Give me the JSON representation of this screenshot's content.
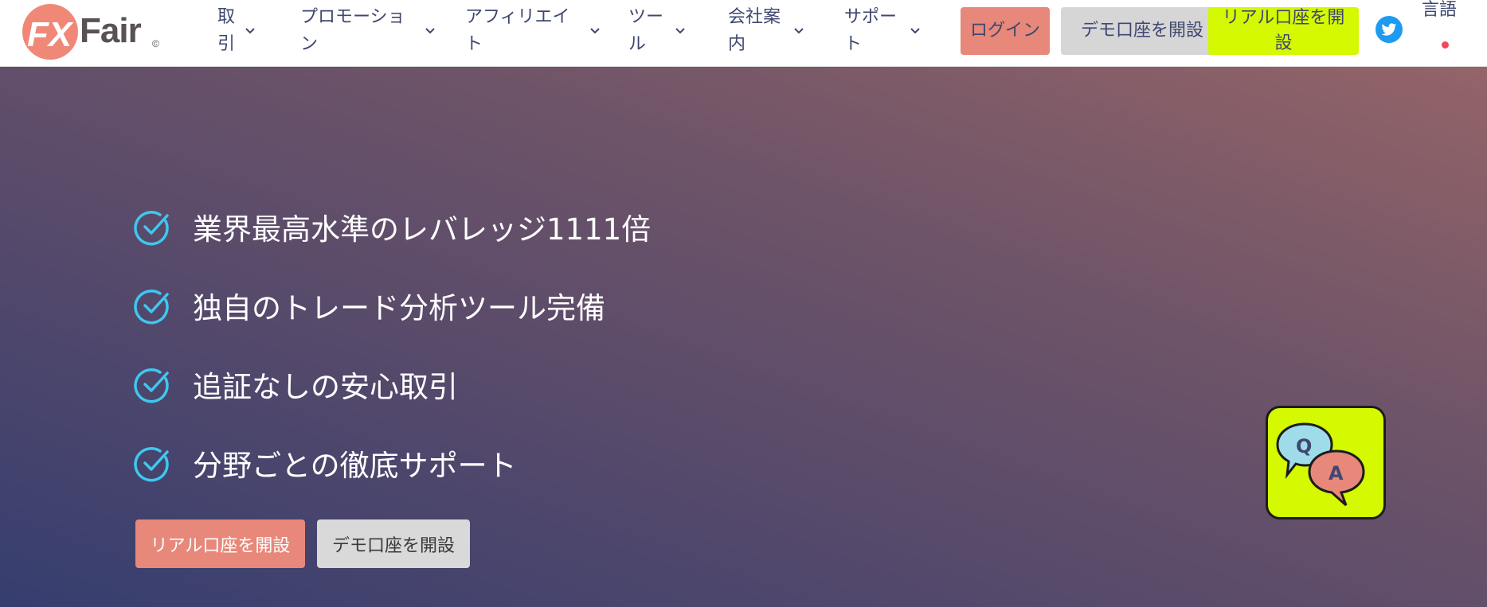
{
  "header": {
    "logo": "FXFair",
    "logo_mark": "©",
    "nav": [
      {
        "label": "取引"
      },
      {
        "label": "プロモーション"
      },
      {
        "label": "アフィリエイト"
      },
      {
        "label": "ツール"
      },
      {
        "label": "会社案内"
      },
      {
        "label": "サポート"
      }
    ],
    "login_label": "ログイン",
    "demo_label": "デモ口座を開設",
    "real_label": "リアル口座を開設",
    "language_label": "言語",
    "social_icon": "twitter-icon"
  },
  "hero": {
    "features": [
      {
        "text": "業界最高水準のレバレッジ1111倍"
      },
      {
        "text": "独自のトレード分析ツール完備"
      },
      {
        "text": "追証なしの安心取引"
      },
      {
        "text": "分野ごとの徹底サポート"
      }
    ],
    "cta_real": "リアル口座を開設",
    "cta_demo": "デモ口座を開設",
    "qa_q": "Q",
    "qa_a": "A"
  },
  "colors": {
    "accent_lime": "#d4f900",
    "accent_salmon": "#e7887a",
    "check_cyan": "#3ec8f0",
    "nav_text": "#3f4770"
  }
}
